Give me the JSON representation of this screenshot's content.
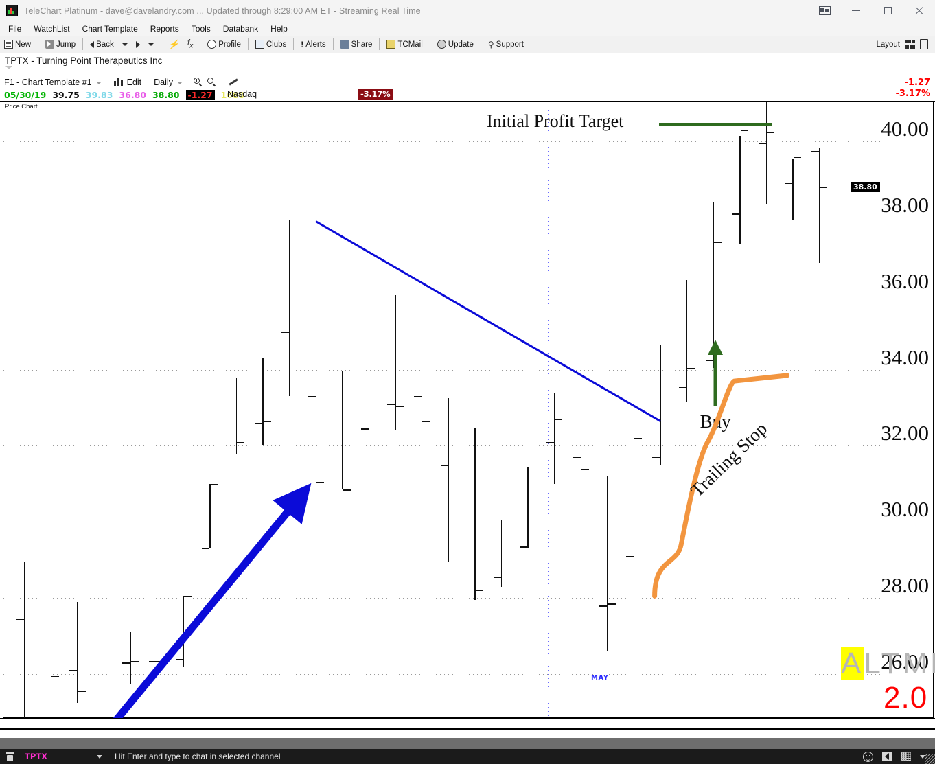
{
  "window": {
    "title": "TeleChart Platinum - dave@davelandry.com  ... Updated through 8:29:00 AM ET  -  Streaming Real Time",
    "logo_icon": "telechart-logo-icon",
    "restore_icon": "restore-layout-icon",
    "minimize_icon": "minimize-icon",
    "maximize_icon": "maximize-icon",
    "close_icon": "close-icon"
  },
  "menu": {
    "items": [
      {
        "label": "File"
      },
      {
        "label": "WatchList"
      },
      {
        "label": "Chart Template"
      },
      {
        "label": "Reports"
      },
      {
        "label": "Tools"
      },
      {
        "label": "Databank"
      },
      {
        "label": "Help"
      }
    ]
  },
  "toolbar": {
    "buttons": [
      {
        "label": "New",
        "icon": "new-document-icon"
      },
      {
        "label": "Jump",
        "icon": "jump-icon"
      },
      {
        "label": "Back",
        "icon": "back-arrow-icon"
      },
      {
        "label": "",
        "icon": "forward-arrow-icon"
      },
      {
        "label": "",
        "icon": "lightning-bolt-icon"
      },
      {
        "label": "",
        "icon": "function-fx-icon"
      },
      {
        "label": "Profile",
        "icon": "profile-icon"
      },
      {
        "label": "Clubs",
        "icon": "clubs-icon"
      },
      {
        "label": "Alerts",
        "icon": "alert-exclamation-icon"
      },
      {
        "label": "Share",
        "icon": "share-icon"
      },
      {
        "label": "TCMail",
        "icon": "mail-icon"
      },
      {
        "label": "Update",
        "icon": "update-icon"
      },
      {
        "label": "Support",
        "icon": "support-key-icon"
      }
    ],
    "layout_label": "Layout",
    "layout_grid_icon": "layout-grid-icon",
    "layout_page_icon": "layout-page-icon"
  },
  "symbol": {
    "header": "TPTX  -  Turning Point Therapeutics Inc",
    "ticker": "TPTX",
    "company": "Turning Point Therapeutics Inc"
  },
  "template": {
    "name": "F1 - Chart Template #1",
    "edit_label": "Edit",
    "period_label": "Daily",
    "bars_icon": "bar-chart-icon",
    "zoom_in_icon": "zoom-in-icon",
    "zoom_out_icon": "zoom-out-icon",
    "draw_icon": "pencil-draw-icon"
  },
  "quote": {
    "date": "05/30/19",
    "open": "39.75",
    "high": "39.83",
    "low": "36.80",
    "close": "38.80",
    "change": "-1.27",
    "volume": "1680",
    "exchange": "Nasdaq",
    "percent_badge": "-3.17%",
    "right_change": "-1.27",
    "right_percent": "-3.17%"
  },
  "chart": {
    "pane_label": "Price Chart",
    "last_price_tag": "38.80",
    "month_label": "MAY",
    "annotations": {
      "profit_target": "Initial Profit Target",
      "buy": "Buy",
      "trailing_stop": "Trailing Stop"
    },
    "colors": {
      "trendline": "#0b0bd8",
      "profit_target_line": "#2f6b1f",
      "buy_arrow": "#2f6b1f",
      "trailing_stop": "#f2953f",
      "bar": "#111111",
      "grid": "#9a9a9a",
      "month_grid": "#6a6aff"
    }
  },
  "watermark": {
    "text_a": "A",
    "text_rest": "LTML",
    "version": "2.0"
  },
  "statusbar": {
    "chat_icon": "chat-window-icon",
    "symbol": "TPTX",
    "dropdown_icon": "chevron-down-icon",
    "hint": "Hit Enter and type to chat in selected channel",
    "smiley_icon": "smiley-icon",
    "speaker_icon": "speaker-icon",
    "grid_icon": "grid-icon",
    "more_icon": "chevron-down-icon"
  },
  "chart_data": {
    "type": "line",
    "subtype": "ohlc-bar",
    "title": "TPTX - Turning Point Therapeutics Inc (Daily)",
    "xlabel": "",
    "ylabel": "Price",
    "ylim": [
      24.6,
      41.6
    ],
    "yticks": [
      40.0,
      38.0,
      36.0,
      34.0,
      32.0,
      30.0,
      28.0,
      26.0
    ],
    "ytick_labels": [
      "40.00",
      "38.00",
      "36.00",
      "34.00",
      "32.00",
      "30.00",
      "28.00",
      "26.00"
    ],
    "grid": true,
    "legend": "none",
    "month_dividers": [
      {
        "label": "MAY",
        "x_index": 20
      }
    ],
    "last_close": 38.8,
    "bars": [
      {
        "i": 0,
        "open": 27.45,
        "high": 28.95,
        "low": 24.7,
        "close": 24.7
      },
      {
        "i": 1,
        "open": 27.3,
        "high": 28.7,
        "low": 25.55,
        "close": 25.95
      },
      {
        "i": 2,
        "open": 26.1,
        "high": 27.9,
        "low": 25.25,
        "close": 25.55
      },
      {
        "i": 3,
        "open": 25.8,
        "high": 26.85,
        "low": 25.4,
        "close": 26.2
      },
      {
        "i": 4,
        "open": 26.3,
        "high": 27.1,
        "low": 25.75,
        "close": 26.35
      },
      {
        "i": 5,
        "open": 26.35,
        "high": 27.55,
        "low": 26.0,
        "close": 26.35
      },
      {
        "i": 6,
        "open": 26.4,
        "high": 28.05,
        "low": 26.2,
        "close": 28.05
      },
      {
        "i": 7,
        "open": 29.3,
        "high": 31.0,
        "low": 29.3,
        "close": 31.0
      },
      {
        "i": 8,
        "open": 32.3,
        "high": 33.8,
        "low": 31.8,
        "close": 32.1
      },
      {
        "i": 9,
        "open": 32.6,
        "high": 34.3,
        "low": 32.0,
        "close": 32.65
      },
      {
        "i": 10,
        "open": 35.0,
        "high": 37.95,
        "low": 33.3,
        "close": 37.95
      },
      {
        "i": 11,
        "open": 33.3,
        "high": 34.1,
        "low": 30.9,
        "close": 31.05
      },
      {
        "i": 12,
        "open": 33.0,
        "high": 33.95,
        "low": 30.85,
        "close": 30.85
      },
      {
        "i": 13,
        "open": 32.45,
        "high": 36.85,
        "low": 31.95,
        "close": 33.4
      },
      {
        "i": 14,
        "open": 33.1,
        "high": 35.95,
        "low": 32.4,
        "close": 33.05
      },
      {
        "i": 15,
        "open": 33.3,
        "high": 33.85,
        "low": 32.1,
        "close": 32.65
      },
      {
        "i": 16,
        "open": 31.5,
        "high": 33.25,
        "low": 28.95,
        "close": 31.9
      },
      {
        "i": 17,
        "open": 31.9,
        "high": 32.45,
        "low": 27.95,
        "close": 28.2
      },
      {
        "i": 18,
        "open": 28.55,
        "high": 30.05,
        "low": 28.3,
        "close": 29.2
      },
      {
        "i": 19,
        "open": 29.35,
        "high": 31.45,
        "low": 29.3,
        "close": 30.35
      },
      {
        "i": 20,
        "open": 32.1,
        "high": 33.4,
        "low": 31.0,
        "close": 32.7
      },
      {
        "i": 21,
        "open": 31.7,
        "high": 34.4,
        "low": 31.25,
        "close": 31.4
      },
      {
        "i": 22,
        "open": 27.8,
        "high": 31.2,
        "low": 26.6,
        "close": 27.85
      },
      {
        "i": 23,
        "open": 29.1,
        "high": 32.95,
        "low": 28.9,
        "close": 32.2
      },
      {
        "i": 24,
        "open": 31.7,
        "high": 34.65,
        "low": 31.5,
        "close": 33.35
      },
      {
        "i": 25,
        "open": 33.55,
        "high": 36.35,
        "low": 33.15,
        "close": 34.05
      },
      {
        "i": 26,
        "open": 34.25,
        "high": 38.4,
        "low": 34.05,
        "close": 37.35
      },
      {
        "i": 27,
        "open": 38.1,
        "high": 40.15,
        "low": 37.3,
        "close": 40.3
      },
      {
        "i": 28,
        "open": 39.95,
        "high": 41.55,
        "low": 38.35,
        "close": 40.25
      },
      {
        "i": 29,
        "open": 38.9,
        "high": 39.55,
        "low": 37.95,
        "close": 39.6
      },
      {
        "i": 30,
        "open": 39.75,
        "high": 39.83,
        "low": 36.8,
        "close": 38.8
      }
    ],
    "overlays": [
      {
        "name": "downtrend-line",
        "type": "trendline",
        "color": "#0b0bd8",
        "from": {
          "x_index": 11,
          "price": 37.9
        },
        "to": {
          "x_index": 24,
          "price": 32.65
        }
      },
      {
        "name": "uptrend-arrow",
        "type": "arrow",
        "color": "#0b0bd8",
        "from": {
          "x_index": 4,
          "price": 26.6
        },
        "to": {
          "x_index": 11,
          "price": 32.3
        }
      },
      {
        "name": "initial-profit-target",
        "type": "horizontal-line",
        "color": "#2f6b1f",
        "price": 40.45,
        "label": "Initial Profit Target"
      },
      {
        "name": "buy-signal",
        "type": "arrow-up",
        "color": "#2f6b1f",
        "x_index": 26,
        "price": 32.95,
        "label": "Buy"
      },
      {
        "name": "trailing-stop",
        "type": "curve",
        "color": "#f2953f",
        "label": "Trailing Stop",
        "points": [
          {
            "x_index": 26,
            "price": 28.05
          },
          {
            "x_index": 27,
            "price": 29.4
          },
          {
            "x_index": 28,
            "price": 32.1
          },
          {
            "x_index": 29,
            "price": 33.7
          },
          {
            "x_index": 31,
            "price": 33.85
          }
        ]
      }
    ]
  }
}
